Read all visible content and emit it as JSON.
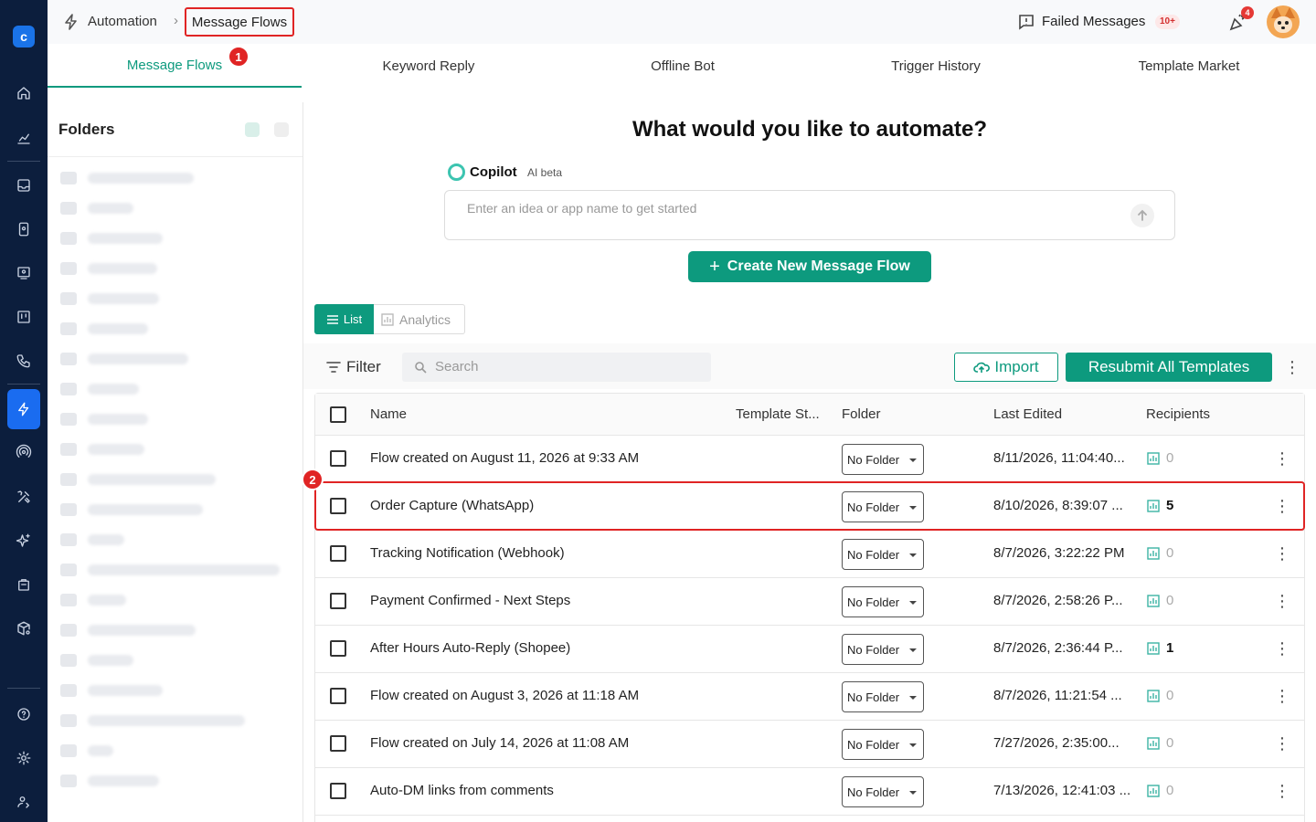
{
  "breadcrumb": {
    "parent": "Automation",
    "separator": "›",
    "current": "Message Flows"
  },
  "header": {
    "failed_messages_label": "Failed Messages",
    "failed_messages_badge": "10+",
    "notifications_badge": "4"
  },
  "tabs": [
    {
      "label": "Message Flows",
      "active": true
    },
    {
      "label": "Keyword Reply"
    },
    {
      "label": "Offline Bot"
    },
    {
      "label": "Trigger History"
    },
    {
      "label": "Template Market"
    }
  ],
  "annotations": {
    "marker1": "1",
    "marker2": "2"
  },
  "folders": {
    "title": "Folders",
    "item_count": 21
  },
  "main": {
    "headline": "What would you like to automate?",
    "copilot_label": "Copilot",
    "copilot_badge": "AI beta",
    "prompt_placeholder": "Enter an idea or app name to get started",
    "create_button": "Create New Message Flow",
    "create_plus": "+"
  },
  "view_toggle": {
    "list": "List",
    "analytics": "Analytics"
  },
  "toolbar": {
    "filter": "Filter",
    "search_placeholder": "Search",
    "import": "Import",
    "resubmit": "Resubmit All Templates",
    "more": "⋮"
  },
  "table": {
    "columns": {
      "name": "Name",
      "template_status": "Template St...",
      "folder": "Folder",
      "last_edited": "Last Edited",
      "recipients": "Recipients"
    },
    "rows": [
      {
        "name": "Flow created on August 11, 2026 at 9:33 AM",
        "folder": "No Folder",
        "last_edited": "8/11/2026, 11:04:40...",
        "recipients": "0",
        "more": "⋮"
      },
      {
        "name": "Order Capture (WhatsApp)",
        "folder": "No Folder",
        "last_edited": "8/10/2026, 8:39:07 ...",
        "recipients": "5",
        "more": "⋮"
      },
      {
        "name": "Tracking Notification (Webhook)",
        "folder": "No Folder",
        "last_edited": "8/7/2026, 3:22:22 PM",
        "recipients": "0",
        "more": "⋮"
      },
      {
        "name": "Payment Confirmed - Next Steps",
        "folder": "No Folder",
        "last_edited": "8/7/2026, 2:58:26 P...",
        "recipients": "0",
        "more": "⋮"
      },
      {
        "name": "After Hours Auto-Reply (Shopee)",
        "folder": "No Folder",
        "last_edited": "8/7/2026, 2:36:44 P...",
        "recipients": "1",
        "more": "⋮"
      },
      {
        "name": "Flow created on August 3, 2026 at 11:18 AM",
        "folder": "No Folder",
        "last_edited": "8/7/2026, 11:21:54 ...",
        "recipients": "0",
        "more": "⋮"
      },
      {
        "name": "Flow created on July 14, 2026 at 11:08 AM",
        "folder": "No Folder",
        "last_edited": "7/27/2026, 2:35:00...",
        "recipients": "0",
        "more": "⋮"
      },
      {
        "name": "Auto-DM links from comments",
        "folder": "No Folder",
        "last_edited": "7/13/2026, 12:41:03 ...",
        "recipients": "0",
        "more": "⋮"
      }
    ]
  },
  "colors": {
    "accent": "#0d9a7e",
    "rail": "#0c1e3d",
    "rail_active": "#1a6cf0",
    "highlight": "#e02424"
  }
}
